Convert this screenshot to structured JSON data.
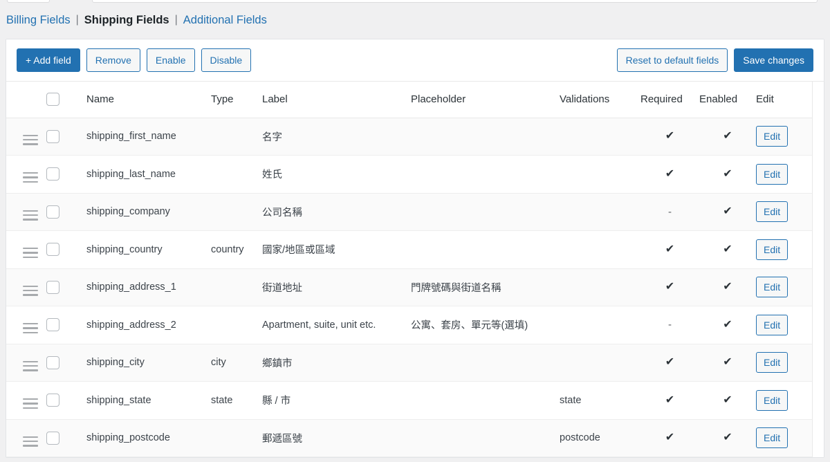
{
  "tabs": [
    {
      "label": "Billing Fields",
      "active": false
    },
    {
      "label": "Shipping Fields",
      "active": true
    },
    {
      "label": "Additional Fields",
      "active": false
    }
  ],
  "tab_separator": "|",
  "toolbar": {
    "add_field_label": "+ Add field",
    "remove_label": "Remove",
    "enable_label": "Enable",
    "disable_label": "Disable",
    "reset_label": "Reset to default fields",
    "save_label": "Save changes"
  },
  "colors": {
    "accent_blue": "#2271b1",
    "page_background": "#f0f0f1",
    "panel_background": "#ffffff",
    "row_stripe": "#fafafa",
    "text": "#3c434a"
  },
  "table": {
    "columns": [
      {
        "key": "drag",
        "label": ""
      },
      {
        "key": "select",
        "label": ""
      },
      {
        "key": "name",
        "label": "Name"
      },
      {
        "key": "type",
        "label": "Type"
      },
      {
        "key": "label",
        "label": "Label"
      },
      {
        "key": "placeholder",
        "label": "Placeholder"
      },
      {
        "key": "validations",
        "label": "Validations"
      },
      {
        "key": "required",
        "label": "Required"
      },
      {
        "key": "enabled",
        "label": "Enabled"
      },
      {
        "key": "edit",
        "label": "Edit"
      }
    ],
    "edit_button_label": "Edit",
    "check_glyph": "✔",
    "dash_glyph": "-",
    "rows": [
      {
        "name": "shipping_first_name",
        "type": "",
        "label": "名字",
        "placeholder": "",
        "validations": "",
        "required": "✔",
        "enabled": "✔",
        "edit": "Edit"
      },
      {
        "name": "shipping_last_name",
        "type": "",
        "label": "姓氏",
        "placeholder": "",
        "validations": "",
        "required": "✔",
        "enabled": "✔",
        "edit": "Edit"
      },
      {
        "name": "shipping_company",
        "type": "",
        "label": "公司名稱",
        "placeholder": "",
        "validations": "",
        "required": "-",
        "enabled": "✔",
        "edit": "Edit"
      },
      {
        "name": "shipping_country",
        "type": "country",
        "label": "國家/地區或區域",
        "placeholder": "",
        "validations": "",
        "required": "✔",
        "enabled": "✔",
        "edit": "Edit"
      },
      {
        "name": "shipping_address_1",
        "type": "",
        "label": "街道地址",
        "placeholder": "門牌號碼與街道名稱",
        "validations": "",
        "required": "✔",
        "enabled": "✔",
        "edit": "Edit"
      },
      {
        "name": "shipping_address_2",
        "type": "",
        "label": "Apartment, suite, unit etc.",
        "placeholder": "公寓、套房、單元等(選填)",
        "validations": "",
        "required": "-",
        "enabled": "✔",
        "edit": "Edit"
      },
      {
        "name": "shipping_city",
        "type": "city",
        "label": "鄉鎮市",
        "placeholder": "",
        "validations": "",
        "required": "✔",
        "enabled": "✔",
        "edit": "Edit"
      },
      {
        "name": "shipping_state",
        "type": "state",
        "label": "縣 / 市",
        "placeholder": "",
        "validations": "state",
        "required": "✔",
        "enabled": "✔",
        "edit": "Edit"
      },
      {
        "name": "shipping_postcode",
        "type": "",
        "label": "郵遞區號",
        "placeholder": "",
        "validations": "postcode",
        "required": "✔",
        "enabled": "✔",
        "edit": "Edit"
      }
    ]
  }
}
